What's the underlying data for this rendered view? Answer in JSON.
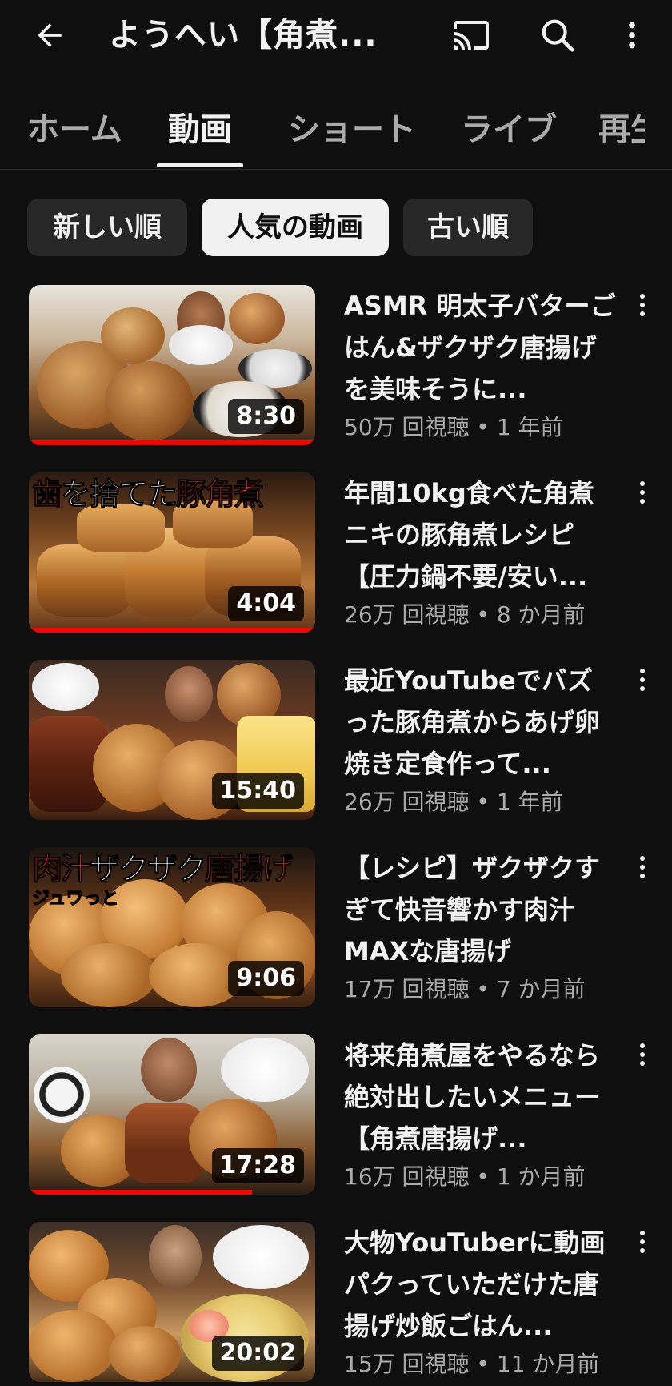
{
  "header": {
    "channel_title": "ようへい【角煮...",
    "icons": {
      "back": "arrow-left-icon",
      "cast": "cast-icon",
      "search": "search-icon",
      "more": "more-vertical-icon"
    }
  },
  "tabs": [
    {
      "label": "ホーム",
      "active": false
    },
    {
      "label": "動画",
      "active": true
    },
    {
      "label": "ショート",
      "active": false
    },
    {
      "label": "ライブ",
      "active": false
    },
    {
      "label": "再生",
      "active": false
    }
  ],
  "chips": [
    {
      "label": "新しい順",
      "selected": false
    },
    {
      "label": "人気の動画",
      "selected": true
    },
    {
      "label": "古い順",
      "selected": false
    }
  ],
  "videos": [
    {
      "title": "ASMR 明太子バターごはん&ザクザク唐揚げを美味そうに...",
      "views": "50万 回視聴 • 1 年前",
      "duration": "8:30",
      "watched_fraction": 1.0,
      "thumb_caption": ""
    },
    {
      "title": "年間10kg食べた角煮ニキの豚角煮レシピ【圧力鍋不要/安い...",
      "views": "26万 回視聴 • 8 か月前",
      "duration": "4:04",
      "watched_fraction": 1.0,
      "thumb_caption_red1": "歯",
      "thumb_caption_white": "を捨てた",
      "thumb_caption_red2": "豚角煮"
    },
    {
      "title": "最近YouTubeでバズった豚角煮からあげ卵焼き定食作って...",
      "views": "26万 回視聴 • 1 年前",
      "duration": "15:40",
      "watched_fraction": 0,
      "thumb_caption": ""
    },
    {
      "title": "【レシピ】ザクザクすぎて快音響かす肉汁MAXな唐揚げ",
      "views": "17万 回視聴 • 7 か月前",
      "duration": "9:06",
      "watched_fraction": 0,
      "thumb_caption_red1": "肉汁",
      "thumb_caption_white": "ザクザク",
      "thumb_caption_red2": "唐揚げ",
      "thumb_caption_small": "ジュワっと"
    },
    {
      "title": "将来角煮屋をやるなら絶対出したいメニュー【角煮唐揚げ...",
      "views": "16万 回視聴 • 1 か月前",
      "duration": "17:28",
      "watched_fraction": 0.78,
      "thumb_caption": ""
    },
    {
      "title": "大物YouTuberに動画パクっていただけた唐揚げ炒飯ごはん...",
      "views": "15万 回視聴 • 11 か月前",
      "duration": "20:02",
      "watched_fraction": 0,
      "thumb_caption": ""
    }
  ],
  "colors": {
    "background": "#0f0f0f",
    "chip_bg": "#272727",
    "chip_selected_bg": "#f1f1f1",
    "progress_red": "#ff0000",
    "secondary_text": "#aaaaaa"
  }
}
